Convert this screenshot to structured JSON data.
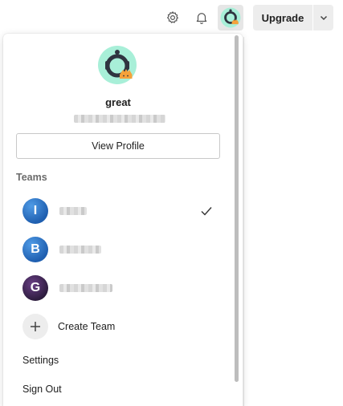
{
  "topbar": {
    "icons": [
      "gear-icon",
      "bell-icon",
      "user-avatar-icon"
    ],
    "upgrade_label": "Upgrade"
  },
  "profile": {
    "name": "great",
    "view_profile_label": "View Profile"
  },
  "teams": {
    "heading": "Teams",
    "items": [
      {
        "initial": "I",
        "color": "#2a73c9",
        "selected": true
      },
      {
        "initial": "B",
        "color": "#2a73c9",
        "selected": false
      },
      {
        "initial": "G",
        "color": "#4a2d5e",
        "selected": false
      }
    ],
    "create_label": "Create Team"
  },
  "menu": {
    "settings_label": "Settings",
    "sign_out_label": "Sign Out"
  },
  "colors": {
    "avatar_mint": "#a8efd8",
    "avatar_dark": "#2f3440",
    "avatar_orange": "#f5a23a"
  }
}
